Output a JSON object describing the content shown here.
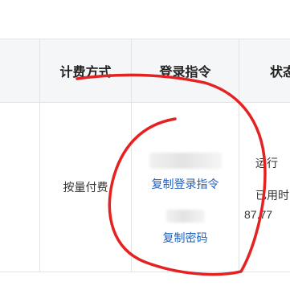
{
  "table": {
    "headers": {
      "billing": "计费方式",
      "login": "登录指令",
      "status": "状态"
    },
    "row": {
      "billing": "按量付费",
      "login": {
        "copy_login_label": "复制登录指令",
        "copy_password_label": "复制密码"
      },
      "status": {
        "running": "运行",
        "used_prefix": "已用时",
        "used_value": "87.77"
      }
    }
  },
  "colors": {
    "link": "#1f5fbf",
    "annotation": "#e52222",
    "header_bg": "#f5f6f8",
    "border": "#dfe4ea"
  }
}
